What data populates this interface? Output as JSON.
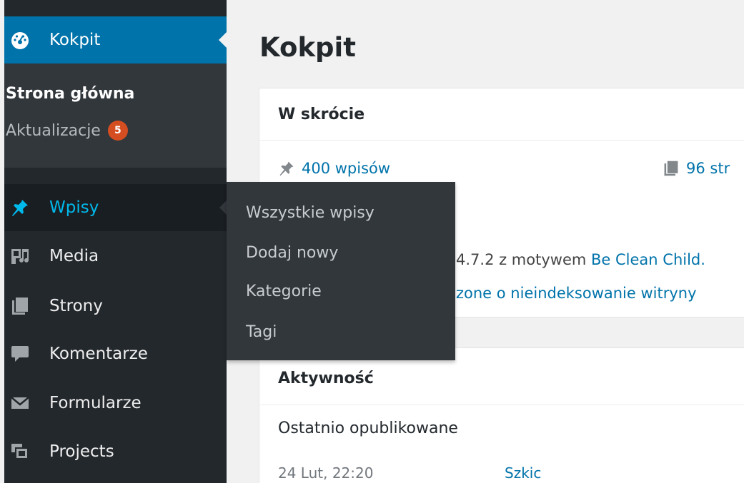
{
  "colors": {
    "sidebar_bg": "#23282d",
    "submenu_bg": "#32373c",
    "accent": "#0073aa",
    "active_text": "#00b9eb",
    "badge": "#d54e21",
    "content_bg": "#f1f1f1"
  },
  "sidebar": {
    "items": [
      {
        "label": "Kokpit",
        "icon": "dashboard-icon",
        "active": true
      },
      {
        "label": "Wpisy",
        "icon": "pin-icon",
        "hover": true
      },
      {
        "label": "Media",
        "icon": "media-icon"
      },
      {
        "label": "Strony",
        "icon": "pages-icon"
      },
      {
        "label": "Komentarze",
        "icon": "comment-icon"
      },
      {
        "label": "Formularze",
        "icon": "envelope-icon"
      },
      {
        "label": "Projects",
        "icon": "projects-icon"
      }
    ],
    "kokpit_submenu": {
      "home": "Strona główna",
      "updates": "Aktualizacje",
      "updates_count": "5"
    }
  },
  "flyout": {
    "items": [
      "Wszystkie wpisy",
      "Dodaj nowy",
      "Kategorie",
      "Tagi"
    ]
  },
  "main": {
    "page_title": "Kokpit",
    "glance": {
      "title": "W skrócie",
      "posts": "400 wpisów",
      "pages": "96 str",
      "version_text": "4.7.2 z motywem",
      "theme_link": "Be Clean Child.",
      "noindex_text": "zone o nieindeksowanie witryny"
    },
    "activity": {
      "title": "Aktywność",
      "subtitle": "Ostatnio opublikowane",
      "date": "24 Lut, 22:20",
      "post_title": "Szkic"
    }
  }
}
